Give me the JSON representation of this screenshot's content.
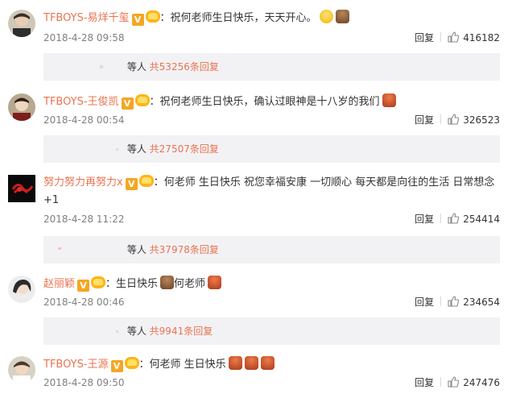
{
  "comments": [
    {
      "username": "TFBOYS-易烊千玺",
      "text": "祝何老师生日快乐，天天开心。",
      "time": "2018-4-28 09:58",
      "reply_label": "回复",
      "likes": "416182",
      "replies_prefix": "等人",
      "replies_more": "共53256条回复",
      "emojis": [
        "smile",
        "cake"
      ]
    },
    {
      "username": "TFBOYS-王俊凯",
      "text": "祝何老师生日快乐，确认过眼神是十八岁的我们",
      "time": "2018-4-28 00:54",
      "reply_label": "回复",
      "likes": "326523",
      "replies_prefix": "等人",
      "replies_more": "共27507条回复",
      "emojis": [
        "cake"
      ]
    },
    {
      "username": "努力努力再努力x",
      "text": "何老师 生日快乐 祝您幸福安康 一切顺心 每天都是向往的生活 日常想念",
      "text_line2": "+1",
      "time": "2018-4-28 11:22",
      "reply_label": "回复",
      "likes": "254414",
      "replies_prefix": "等人",
      "replies_more": "共37978条回复",
      "emojis": []
    },
    {
      "username": "赵丽颖",
      "text_part1": "生日快乐",
      "text_part2": "何老师",
      "time": "2018-4-28 00:46",
      "reply_label": "回复",
      "likes": "234654",
      "replies_prefix": "等人",
      "replies_more": "共9941条回复",
      "emojis": [
        "cake",
        "cake2"
      ]
    },
    {
      "username": "TFBOYS-王源",
      "text": "何老师 生日快乐",
      "time": "2018-4-28 09:50",
      "reply_label": "回复",
      "likes": "247476",
      "emojis": [
        "cake",
        "cake",
        "cake"
      ]
    }
  ],
  "colon": "：",
  "verified_label": "V",
  "colors": {
    "username": "#eb7350",
    "meta": "#808080",
    "reply_box_bg": "#f2f2f5",
    "verified": "#f5a623"
  },
  "icons": {
    "like": "thumbs-up-icon",
    "verified": "verified-v-icon",
    "level": "level-crown-icon"
  }
}
